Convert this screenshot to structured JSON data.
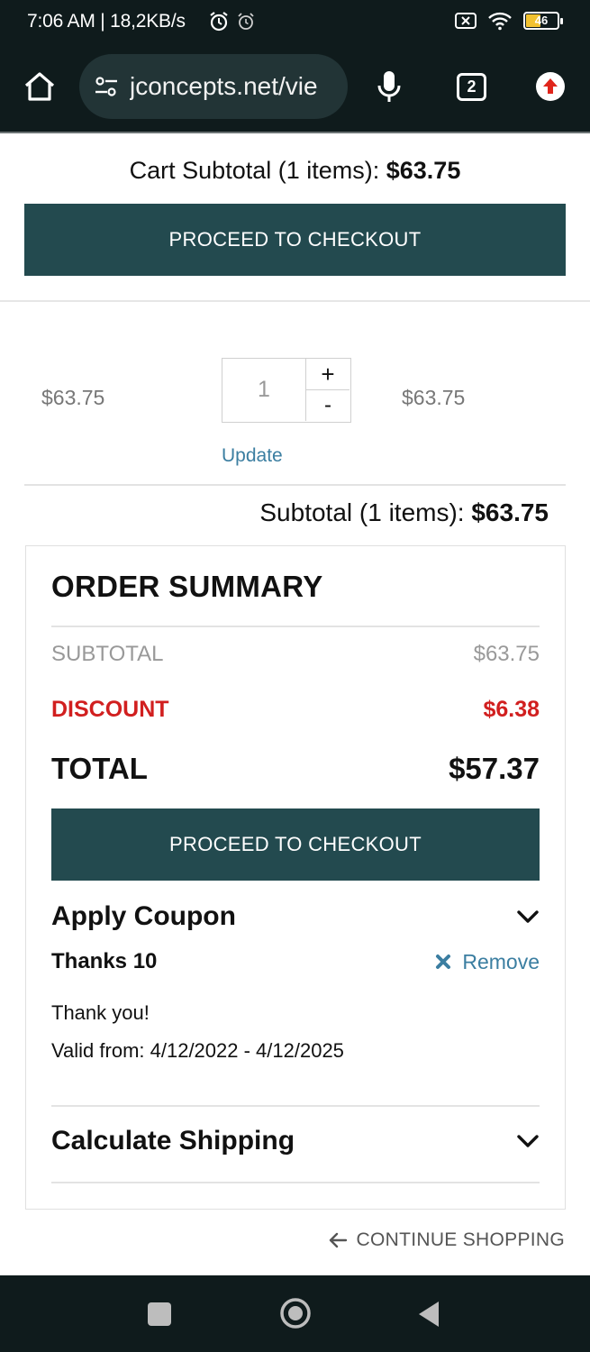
{
  "status_bar": {
    "time": "7:06 AM | 18,2KB/s",
    "battery": "46"
  },
  "browser": {
    "url": "jconcepts.net/vie",
    "tab_count": "2"
  },
  "cart": {
    "subtotal_label": "Cart Subtotal (1 items): ",
    "subtotal_value": "$63.75",
    "checkout_label": "PROCEED TO CHECKOUT"
  },
  "line_item": {
    "price": "$63.75",
    "quantity": "1",
    "plus_label": "+",
    "minus_label": "-",
    "total": "$63.75",
    "update_label": "Update"
  },
  "subtotal_line": {
    "label": "Subtotal (1 items): ",
    "value": "$63.75"
  },
  "order_summary": {
    "title": "ORDER SUMMARY",
    "subtotal_label": "SUBTOTAL",
    "subtotal_value": "$63.75",
    "discount_label": "DISCOUNT",
    "discount_value": "$6.38",
    "total_label": "TOTAL",
    "total_value": "$57.37",
    "checkout_label": "PROCEED TO CHECKOUT",
    "coupon": {
      "title": "Apply Coupon",
      "code": "Thanks 10",
      "remove_label": "Remove",
      "description": "Thank you!",
      "validity": "Valid from: 4/12/2022 - 4/12/2025"
    },
    "shipping_title": "Calculate Shipping"
  },
  "continue_label": "CONTINUE SHOPPING",
  "colors": {
    "brand": "#234a4f",
    "discount": "#d11f1f",
    "link": "#3b7ea1"
  }
}
